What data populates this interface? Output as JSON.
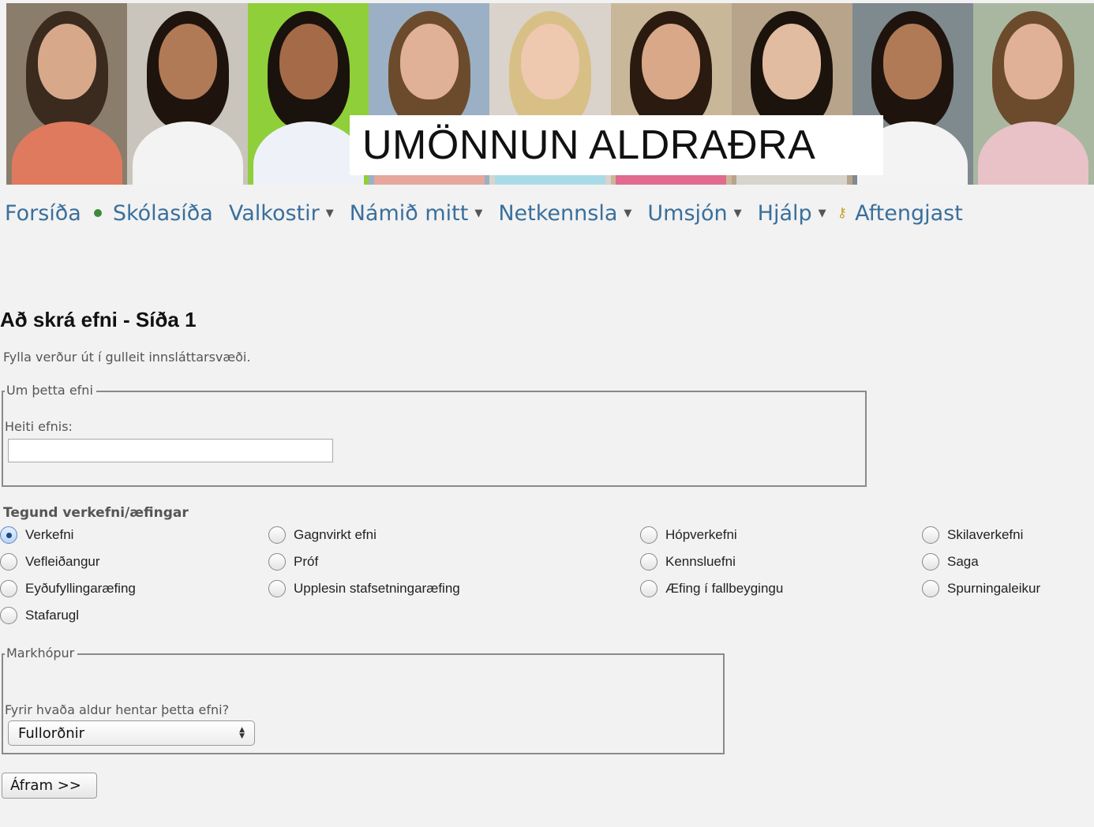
{
  "banner": {
    "title": "UMÖNNUN ALDRAÐRA",
    "photos": [
      {
        "bg": "#8b7d6b",
        "hair": "#3b2a1e",
        "skin": "#d7a98a",
        "shirt": "#e07a5f"
      },
      {
        "bg": "#c9c4bc",
        "hair": "#1f140d",
        "skin": "#b07a57",
        "shirt": "#f3f3f3"
      },
      {
        "bg": "#8fcf3a",
        "hair": "#1a120c",
        "skin": "#a56a48",
        "shirt": "#eef2f8"
      },
      {
        "bg": "#9bb0c4",
        "hair": "#6b4b2c",
        "skin": "#e0b196",
        "shirt": "#e6a79c"
      },
      {
        "bg": "#d9d3cc",
        "hair": "#d8bf86",
        "skin": "#efc8b0",
        "shirt": "#a9dbe6"
      },
      {
        "bg": "#c9b79a",
        "hair": "#2a1a10",
        "skin": "#d9a888",
        "shirt": "#e06b8f"
      },
      {
        "bg": "#b7a48a",
        "hair": "#1c130d",
        "skin": "#e2bca0",
        "shirt": "#d7d3cd"
      },
      {
        "bg": "#7f8a8f",
        "hair": "#1f140d",
        "skin": "#b07a57",
        "shirt": "#f3f3f3"
      },
      {
        "bg": "#a9b7a0",
        "hair": "#6b4b2c",
        "skin": "#e0b196",
        "shirt": "#e8c2c6"
      }
    ]
  },
  "nav": {
    "items": [
      {
        "label": "Forsíða",
        "dropdown": false,
        "icon": null
      },
      {
        "label": "Skólasíða",
        "dropdown": false,
        "icon": "leaf-icon"
      },
      {
        "label": "Valkostir",
        "dropdown": true,
        "icon": null
      },
      {
        "label": "Námið mitt",
        "dropdown": true,
        "icon": null
      },
      {
        "label": "Netkennsla",
        "dropdown": true,
        "icon": null
      },
      {
        "label": "Umsjón",
        "dropdown": true,
        "icon": null
      },
      {
        "label": "Hjálp",
        "dropdown": true,
        "icon": null
      },
      {
        "label": "Aftengjast",
        "dropdown": false,
        "icon": "key-icon"
      }
    ]
  },
  "page": {
    "title": "Að skrá efni - Síða 1",
    "hint": "Fylla verður út í gulleit innsláttarsvæði."
  },
  "about": {
    "legend": "Um þetta efni",
    "name_label": "Heiti efnis:",
    "name_value": ""
  },
  "type": {
    "label": "Tegund verkefni/æfingar",
    "options": [
      {
        "label": "Verkefni",
        "checked": true
      },
      {
        "label": "Gagnvirkt efni",
        "checked": false
      },
      {
        "label": "Hópverkefni",
        "checked": false
      },
      {
        "label": "Skilaverkefni",
        "checked": false
      },
      {
        "label": "Vefleiðangur",
        "checked": false
      },
      {
        "label": "Próf",
        "checked": false
      },
      {
        "label": "Kennsluefni",
        "checked": false
      },
      {
        "label": "Saga",
        "checked": false
      },
      {
        "label": "Eyðufyllingaræfing",
        "checked": false
      },
      {
        "label": "Upplesin stafsetningaræfing",
        "checked": false
      },
      {
        "label": "Æfing í fallbeygingu",
        "checked": false
      },
      {
        "label": "Spurningaleikur",
        "checked": false
      },
      {
        "label": "Stafarugl",
        "checked": false
      }
    ]
  },
  "audience": {
    "legend": "Markhópur",
    "question": "Fyrir hvaða aldur hentar þetta efni?",
    "selected": "Fullorðnir"
  },
  "submit_label": "Áfram >>"
}
